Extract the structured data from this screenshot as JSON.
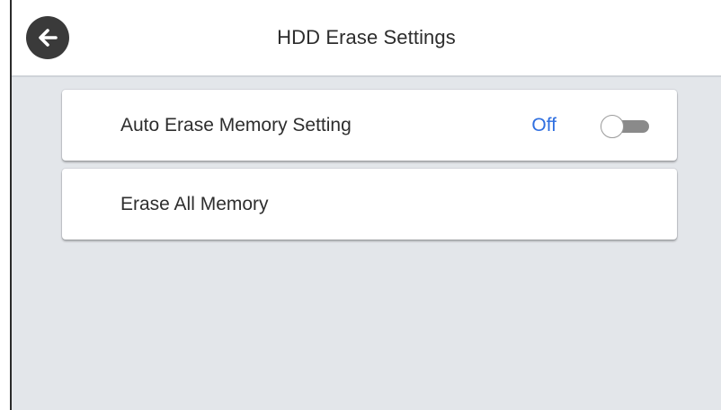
{
  "header": {
    "title": "HDD Erase Settings",
    "back_icon": "back-arrow-icon"
  },
  "settings": [
    {
      "label": "Auto Erase Memory Setting",
      "value": "Off",
      "toggle_on": false
    },
    {
      "label": "Erase All Memory"
    }
  ],
  "colors": {
    "accent": "#2f6fe0",
    "background": "#e3e6ea",
    "header_bg": "#ffffff"
  }
}
